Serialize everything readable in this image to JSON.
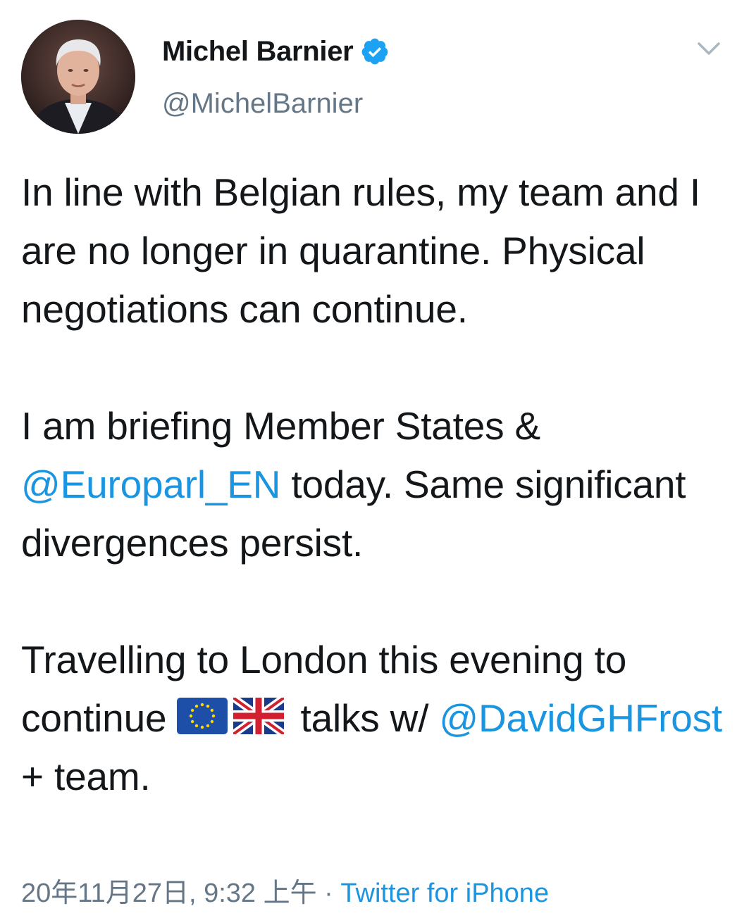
{
  "author": {
    "name": "Michel Barnier",
    "handle": "@MichelBarnier",
    "verified": true
  },
  "icons": {
    "verified": "verified-badge-icon",
    "menu": "chevron-down-icon",
    "eu_flag": "eu-flag-icon",
    "uk_flag": "uk-flag-icon"
  },
  "tweet": {
    "p1": "In line with Belgian rules, my team and I are no longer in quarantine. Physical negotiations can continue.",
    "p2_before": "I am briefing Member States & ",
    "p2_mention": "@Europarl_EN",
    "p2_after": " today. Same significant divergences persist.",
    "p3_before": "Travelling to London this evening to continue ",
    "p3_middle": " talks w/ ",
    "p3_mention": "@DavidGHFrost",
    "p3_after": " + team."
  },
  "footer": {
    "timestamp": "20年11月27日, 9:32 上午 · ",
    "source": "Twitter for iPhone"
  },
  "colors": {
    "link": "#1b95e0",
    "secondary": "#657786",
    "text": "#14171a"
  }
}
